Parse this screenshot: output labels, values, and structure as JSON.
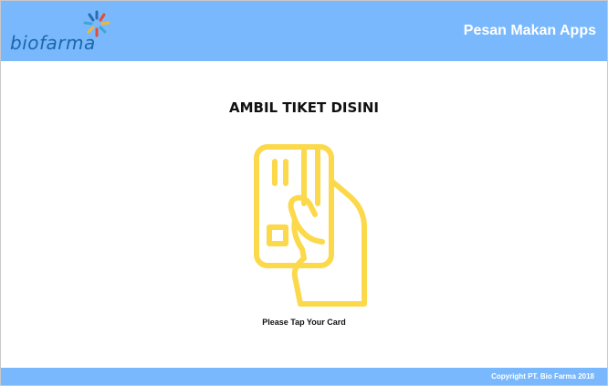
{
  "header": {
    "logo_text": "biofarma",
    "app_title": "Pesan Makan Apps"
  },
  "main": {
    "heading": "AMBIL TIKET DISINI",
    "illustration_icon": "tap-card-icon",
    "instruction": "Please Tap Your Card"
  },
  "footer": {
    "copyright": "Copyright PT. Bio Farma 2018"
  },
  "colors": {
    "header_bg": "#79b8fd",
    "icon_yellow": "#fbd94a",
    "logo_blue": "#1a67a8"
  }
}
